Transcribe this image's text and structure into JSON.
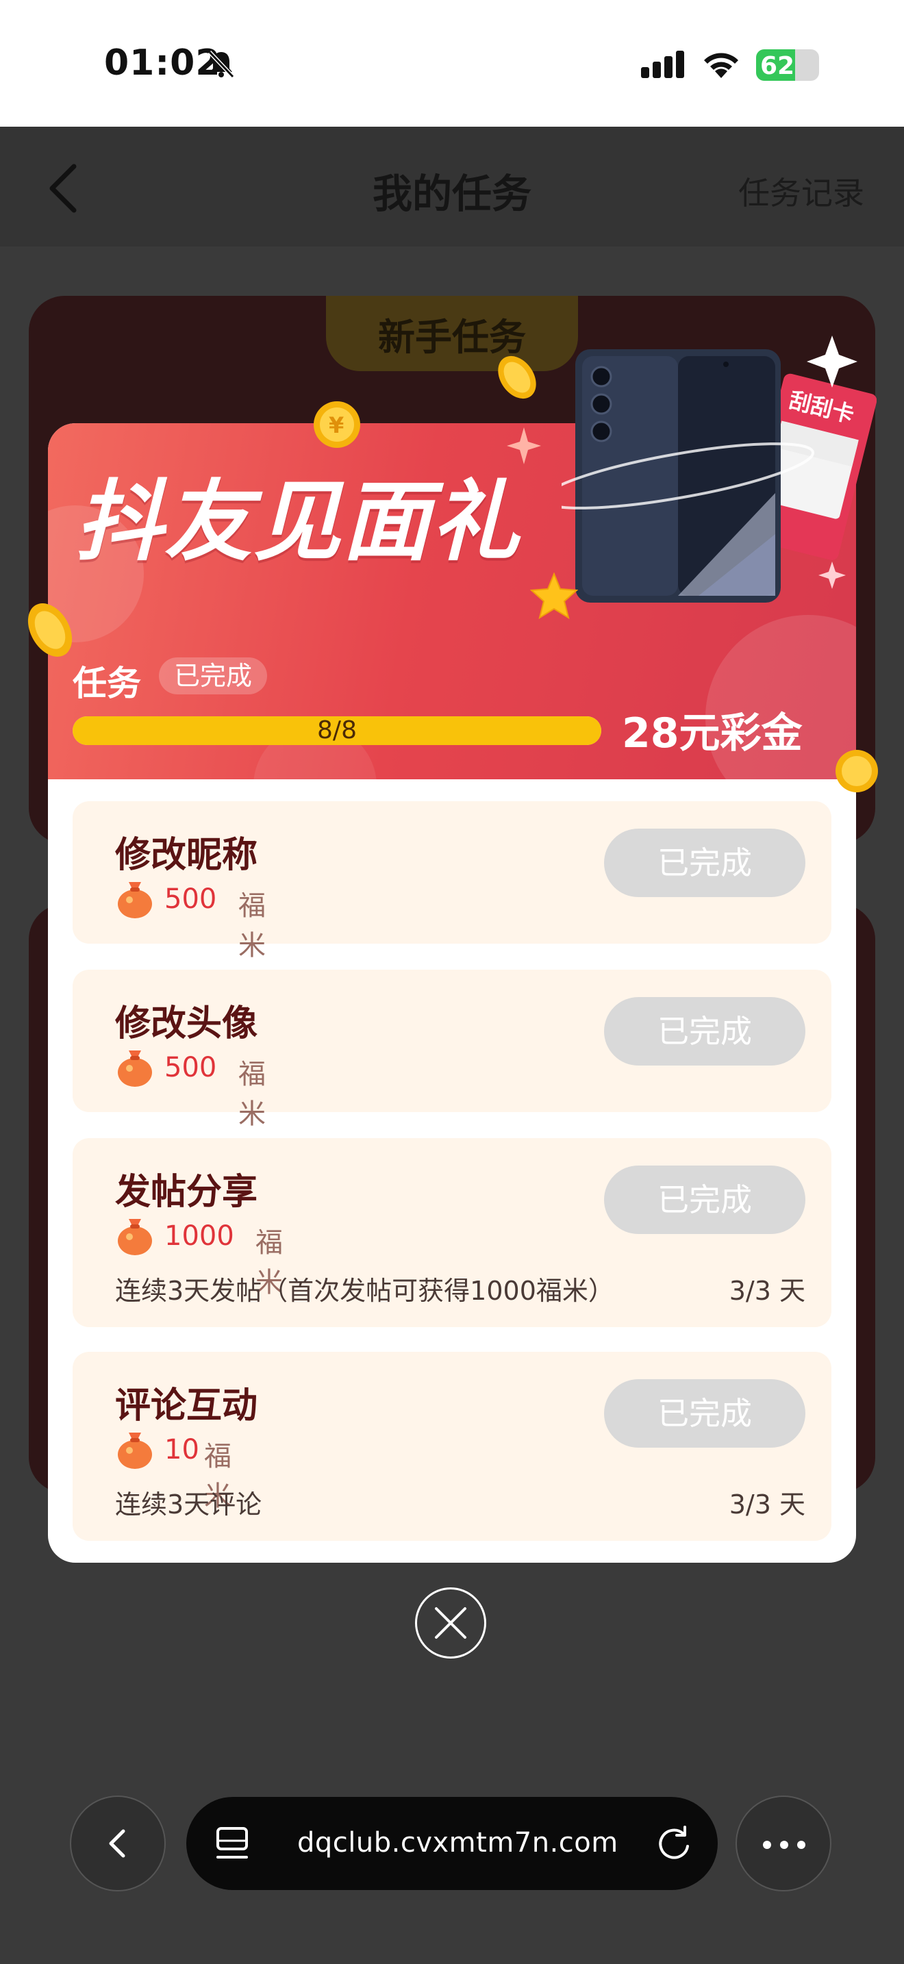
{
  "status_bar": {
    "time": "01:02",
    "battery_level": "62",
    "battery_fraction": 0.62,
    "icons": [
      "bell-off-icon",
      "signal-icon",
      "wifi-icon",
      "battery-icon"
    ]
  },
  "header": {
    "title": "我的任务",
    "right_link": "任务记录",
    "back_icon": "chevron-left-icon"
  },
  "background": {
    "tab_label": "新手任务"
  },
  "modal": {
    "hero_title": "抖友见面礼",
    "task_label": "任务",
    "status": "已完成",
    "progress_text": "8/8",
    "progress_fraction": 1.0,
    "reward": "28元彩金",
    "illustration_card_text": "刮刮卡",
    "tasks": [
      {
        "title": "修改昵称",
        "points": "500",
        "unit": "福米",
        "button": "已完成"
      },
      {
        "title": "修改头像",
        "points": "500",
        "unit": "福米",
        "button": "已完成"
      },
      {
        "title": "发帖分享",
        "points": "1000",
        "unit": "福米",
        "button": "已完成",
        "description": "连续3天发帖（首次发帖可获得1000福米）",
        "count": "3/3 天"
      },
      {
        "title": "评论互动",
        "points": "10",
        "unit": "福米",
        "button": "已完成",
        "description": "连续3天评论",
        "count": "3/3 天"
      }
    ],
    "close_icon": "close-circle-icon"
  },
  "browser_bar": {
    "url": "dqclub.cvxmtm7n.com",
    "icons": [
      "back-icon",
      "tabs-icon",
      "reload-icon",
      "more-icon"
    ]
  },
  "colors": {
    "hero_red": "#e5454d",
    "progress_yellow": "#f9c20a",
    "task_card_bg": "#fff5ea",
    "task_title": "#5a1414",
    "points_red": "#e0343a",
    "done_button_gray": "#d9d9d9"
  }
}
